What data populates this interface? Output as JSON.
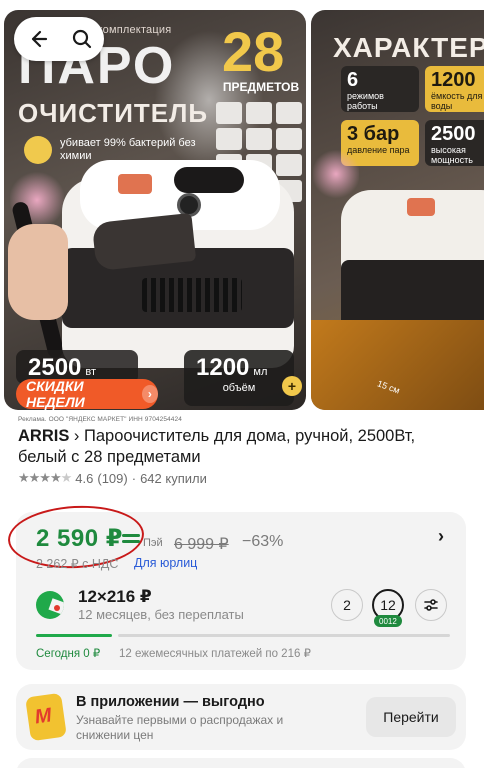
{
  "nav": {
    "back_icon": "arrow-left-icon",
    "search_icon": "search-icon"
  },
  "slide1": {
    "pre_title": "подарочная комплектация",
    "title_line1": "ПАРО",
    "title_line2": "ОЧИСТИТЕЛЬ",
    "count": "28",
    "count_label": "ПРЕДМЕТОВ",
    "germ_text": "убивает 99% бактерий без химии",
    "power_value": "2500",
    "power_unit": "вт",
    "volume_value": "1200",
    "volume_unit": "мл",
    "volume_label": "объём",
    "promo": "СКИДКИ НЕДЕЛИ",
    "promo_arrow": "›",
    "plus": "+"
  },
  "slide2": {
    "title": "ХАРАКТЕРИ",
    "specs": [
      {
        "value": "6",
        "text": "режимов работы",
        "style": "dark"
      },
      {
        "value": "1200",
        "text": "ёмкость для воды",
        "style": "gold"
      },
      {
        "value": "3 бар",
        "text": "давление пара",
        "style": "gold"
      },
      {
        "value": "2500",
        "text": "высокая мощность",
        "style": "dark"
      }
    ],
    "size_label": "15 см"
  },
  "product": {
    "ad_text": "Реклама. ООО \"ЯНДЕКС МАРКЕТ\" ИНН 9704254424",
    "brand": "ARRIS",
    "separator": " › ",
    "title": "Пароочиститель для дома, ручной, 2500Вт, белый с 28 предметами",
    "stars": "★★★★",
    "star_half": "★",
    "rating": "4.6",
    "reviews": "(109)",
    "dot": "·",
    "bought": "642 купили"
  },
  "price": {
    "current": "2 590 ₽",
    "pay_label": "Пэй",
    "old": "6 999 ₽",
    "discount": "−63%",
    "chevron": "›",
    "vat_price": "2 262 ₽ с НДС",
    "legal_link": "Для юрлиц"
  },
  "split": {
    "amount": "12×216 ₽",
    "sub": "12 месяцев, без переплаты",
    "term_options": [
      "2",
      "12"
    ],
    "selected_term_badge": "0012",
    "today": "Сегодня 0 ₽",
    "monthly": "12 ежемесячных платежей по 216 ₽",
    "progress_fraction": 0.08
  },
  "app_promo": {
    "title": "В приложении — выгодно",
    "subtitle": "Узнавайте первыми о распродажах и снижении цен",
    "button": "Перейти"
  },
  "colors": {
    "price_green": "#1f8a3e",
    "promo_orange": "#f05a28",
    "accent_gold": "#f1c84b",
    "link_blue": "#2a5bd7",
    "annotation_red": "#c81919"
  }
}
